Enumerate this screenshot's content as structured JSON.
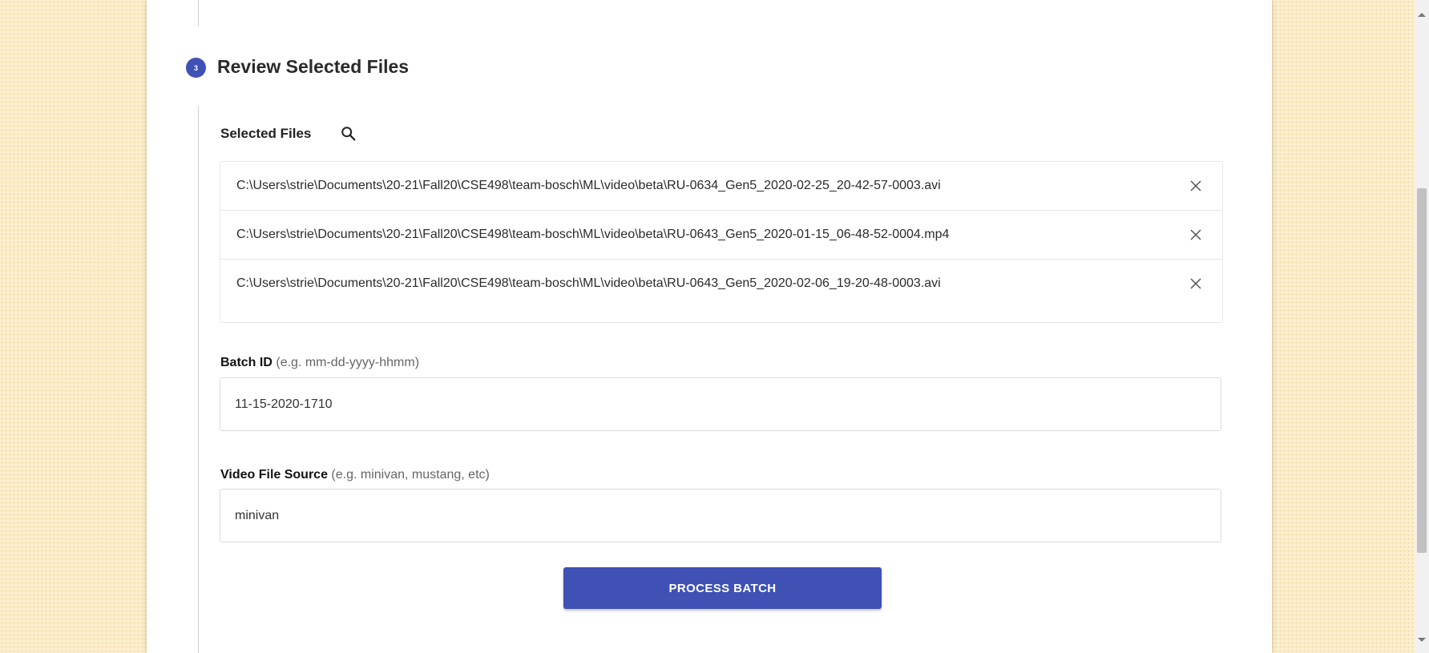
{
  "step": {
    "number": "3",
    "title": "Review Selected Files"
  },
  "selected_files": {
    "title": "Selected Files",
    "search_icon": "search-icon",
    "close_icon": "close-icon",
    "items": [
      "C:\\Users\\strie\\Documents\\20-21\\Fall20\\CSE498\\team-bosch\\ML\\video\\beta\\RU-0634_Gen5_2020-02-25_20-42-57-0003.avi",
      "C:\\Users\\strie\\Documents\\20-21\\Fall20\\CSE498\\team-bosch\\ML\\video\\beta\\RU-0643_Gen5_2020-01-15_06-48-52-0004.mp4",
      "C:\\Users\\strie\\Documents\\20-21\\Fall20\\CSE498\\team-bosch\\ML\\video\\beta\\RU-0643_Gen5_2020-02-06_19-20-48-0003.avi"
    ]
  },
  "batch_id": {
    "label": "Batch ID",
    "hint": "(e.g. mm-dd-yyyy-hhmm)",
    "value": "11-15-2020-1710"
  },
  "video_source": {
    "label": "Video File Source",
    "hint": "(e.g. minivan, mustang, etc)",
    "value": "minivan"
  },
  "process_button": {
    "label": "PROCESS BATCH"
  },
  "colors": {
    "accent": "#3f51b5",
    "background": "#fbefcf"
  }
}
